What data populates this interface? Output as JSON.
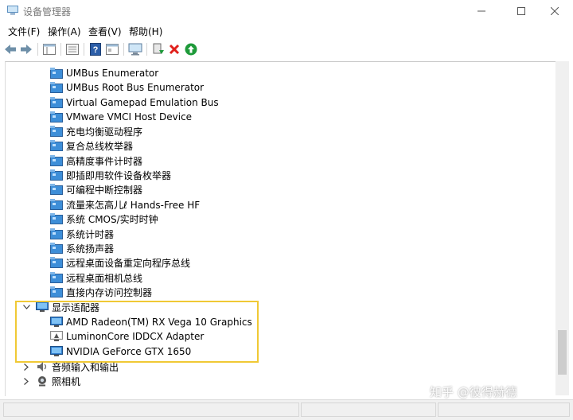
{
  "window": {
    "title": "设备管理器",
    "controls": [
      "minimize-icon",
      "maximize-icon",
      "close-icon"
    ]
  },
  "menu": [
    "文件(F)",
    "操作(A)",
    "查看(V)",
    "帮助(H)"
  ],
  "toolbar": [
    "back-arrow-icon",
    "forward-arrow-icon",
    "properties-icon",
    "view-icon",
    "help-icon",
    "action-icon",
    "monitor-icon",
    "update-driver-icon",
    "uninstall-x-icon",
    "enable-device-icon"
  ],
  "tree": {
    "system_devices_children": [
      "UMBus Enumerator",
      "UMBus Root Bus Enumerator",
      "Virtual Gamepad Emulation Bus",
      "VMware VMCI Host Device",
      "充电均衡驱动程序",
      "复合总线枚举器",
      "高精度事件计时器",
      "即插即用软件设备枚举器",
      "可编程中断控制器",
      "流量来怎高儿ℓ Hands-Free HF",
      "系统 CMOS/实时时钟",
      "系统计时器",
      "系统扬声器",
      "远程桌面设备重定向程序总线",
      "远程桌面相机总线",
      "直接内存访问控制器"
    ],
    "display_adapters": {
      "label": "显示适配器",
      "expanded": true,
      "children": [
        "AMD Radeon(TM) RX Vega 10 Graphics",
        "LuminonCore IDDCX Adapter",
        "NVIDIA GeForce GTX 1650"
      ]
    },
    "audio": {
      "label": "音频输入和输出",
      "expanded": false
    },
    "cameras": {
      "label": "照相机",
      "expanded": false
    }
  },
  "watermark": "知乎 @彼得赫德",
  "colors": {
    "highlight_box": "#f0c935",
    "device_icon_blue": "#3d8ed8",
    "uninstall_red": "#e0201b",
    "enable_green": "#1e9a3a"
  }
}
